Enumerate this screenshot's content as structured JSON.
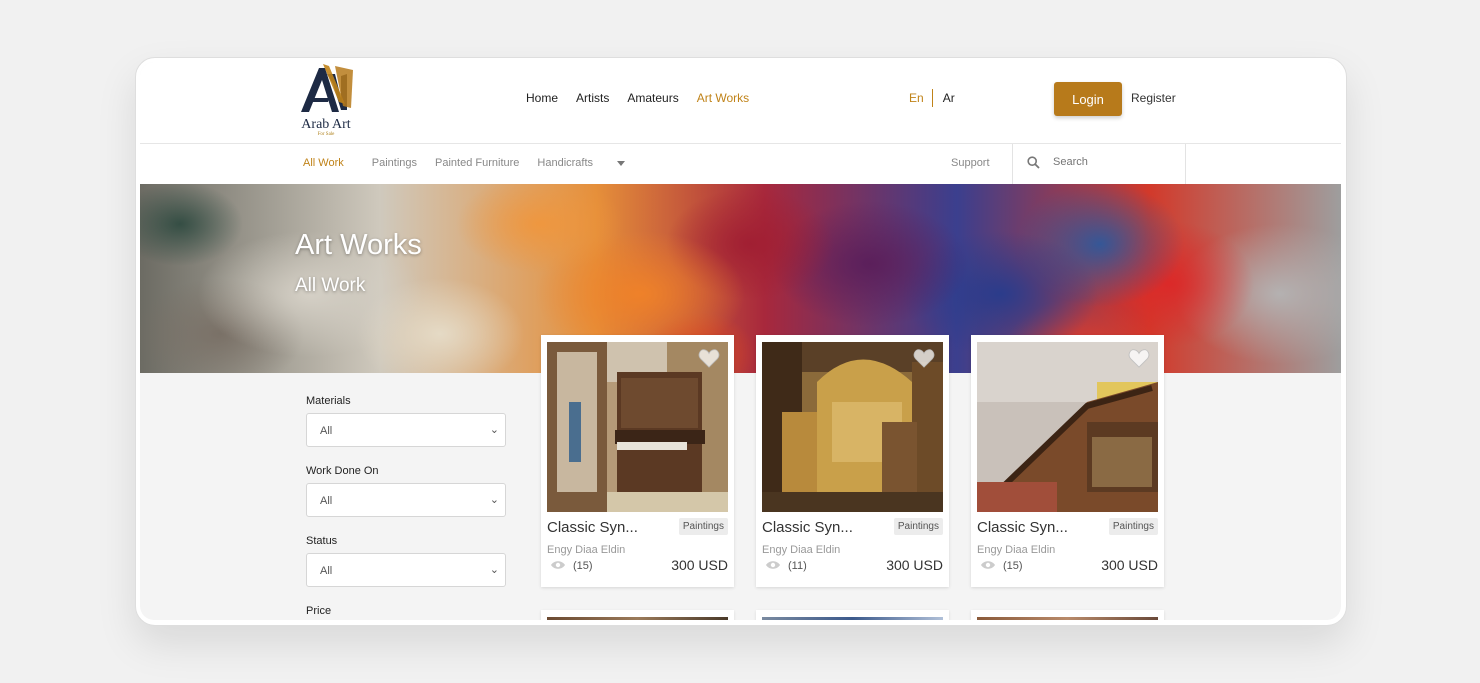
{
  "brand": {
    "name": "Arab Art",
    "tagline": "For Sale"
  },
  "nav": {
    "items": [
      "Home",
      "Artists",
      "Amateurs",
      "Art Works"
    ],
    "active": "Art Works"
  },
  "language": {
    "en": "En",
    "ar": "Ar",
    "active": "En"
  },
  "auth": {
    "login": "Login",
    "register": "Register"
  },
  "subnav": {
    "all": "All Work",
    "paintings": "Paintings",
    "furniture": "Painted Furniture",
    "handicrafts": "Handicrafts",
    "support": "Support"
  },
  "search": {
    "placeholder": "Search"
  },
  "hero": {
    "title": "Art Works",
    "subtitle": "All Work"
  },
  "filters": {
    "materials_label": "Materials",
    "materials_value": "All",
    "workdone_label": "Work Done On",
    "workdone_value": "All",
    "status_label": "Status",
    "status_value": "All",
    "price_label": "Price"
  },
  "cards": [
    {
      "title": "Classic Syn...",
      "category": "Paintings",
      "artist": "Engy Diaa Eldin",
      "views": "(15)",
      "price": "300 USD"
    },
    {
      "title": "Classic Syn...",
      "category": "Paintings",
      "artist": "Engy Diaa Eldin",
      "views": "(11)",
      "price": "300 USD"
    },
    {
      "title": "Classic Syn...",
      "category": "Paintings",
      "artist": "Engy Diaa Eldin",
      "views": "(15)",
      "price": "300 USD"
    }
  ],
  "colors": {
    "accent": "#b77a1b",
    "accent_text": "#c08319",
    "background": "#f4f4f4"
  }
}
